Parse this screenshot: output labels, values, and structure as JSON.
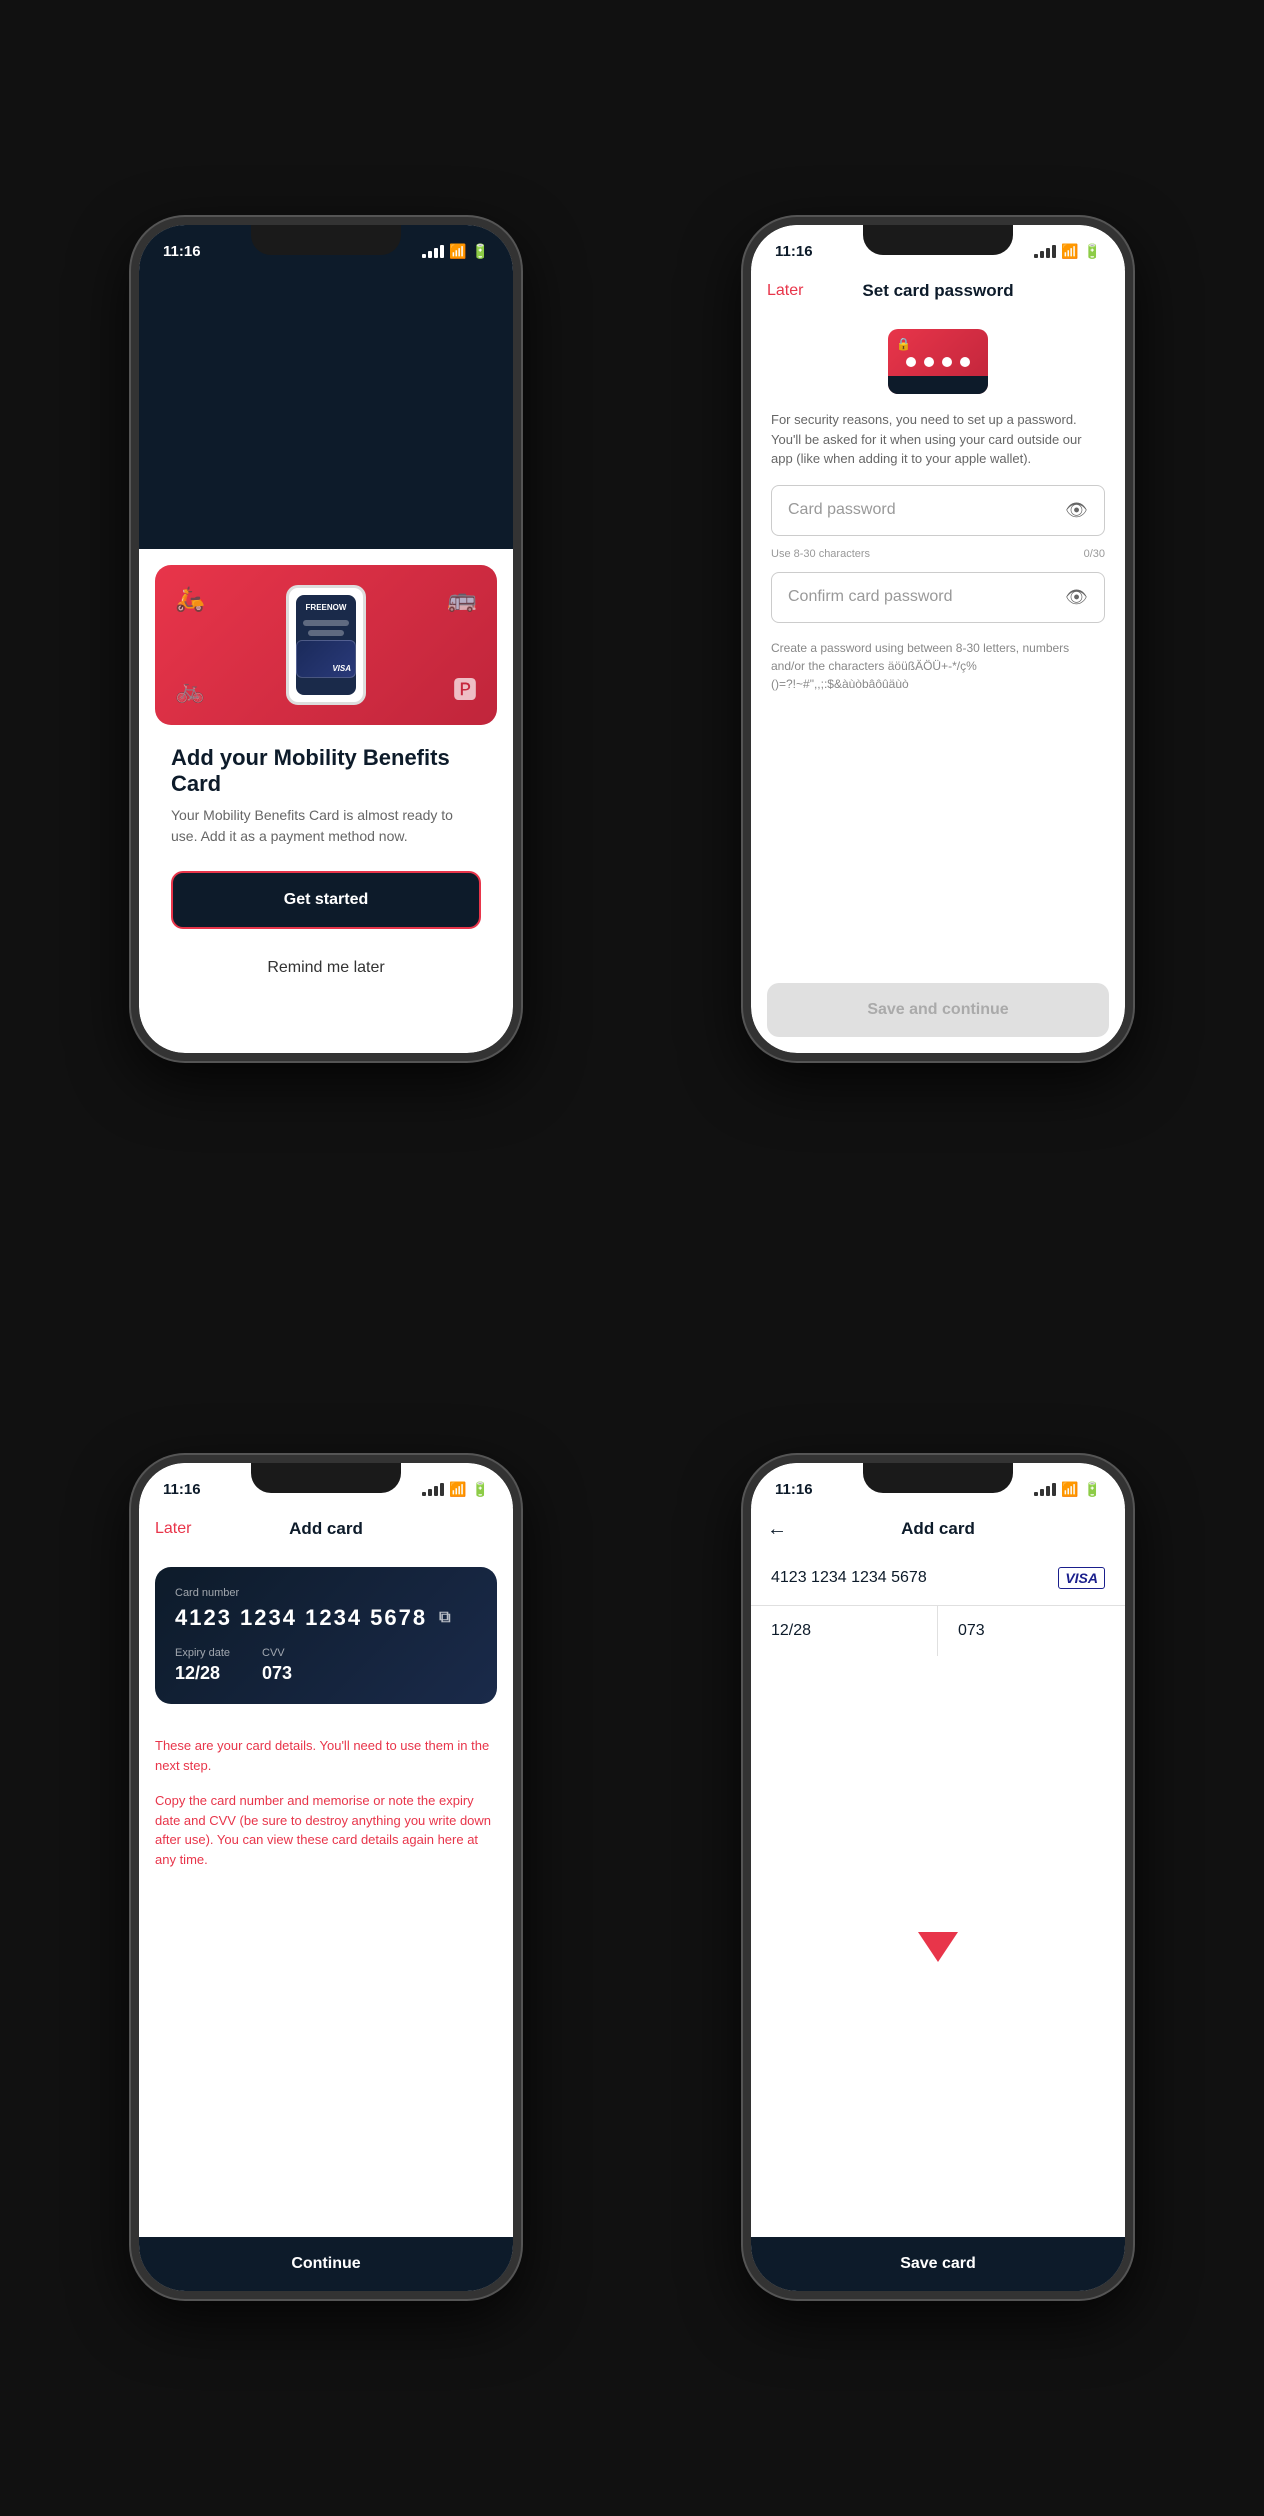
{
  "screens": {
    "screen1": {
      "status_time": "11:16",
      "promo_title": "Add your Mobility Benefits Card",
      "promo_desc": "Your Mobility Benefits Card is almost ready to use. Add it as a payment method now.",
      "get_started_label": "Get started",
      "remind_later_label": "Remind me later"
    },
    "screen2": {
      "status_time": "11:16",
      "nav_later": "Later",
      "nav_title": "Set card password",
      "security_desc": "For security reasons, you need to set up a password. You'll be asked for it when using your card outside our app (like when adding it to your apple wallet).",
      "card_password_placeholder": "Card password",
      "confirm_password_placeholder": "Confirm card password",
      "hint_chars": "Use 8-30 characters",
      "hint_count": "0/30",
      "password_rules": "Create a password using between 8-30 letters, numbers and/or the characters äöüßÄÖÜ+-*/ç%()=?!~#\",,;:$&àùòbâôûäùò",
      "save_continue_label": "Save and continue"
    },
    "screen3": {
      "status_time": "11:16",
      "nav_later": "Later",
      "nav_title": "Add card",
      "card_number_label": "Card number",
      "card_number": "4123 1234 1234 5678",
      "expiry_label": "Expiry date",
      "expiry_value": "12/28",
      "cvv_label": "CVV",
      "cvv_value": "073",
      "info_text1": "These are your card details. You'll need to use them in the next step.",
      "info_text2": "Copy the card number and memorise or note the expiry date and CVV (be sure to destroy anything you write down after use).\nYou can view these card details again here at any time.",
      "continue_label": "Continue"
    },
    "screen4": {
      "status_time": "11:16",
      "nav_title": "Add card",
      "card_number": "4123 1234 1234 5678",
      "expiry": "12/28",
      "cvv": "073",
      "save_card_label": "Save card"
    }
  }
}
